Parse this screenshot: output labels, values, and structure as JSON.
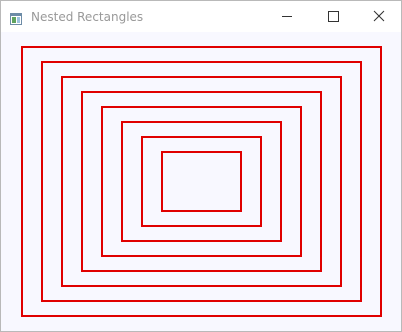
{
  "window": {
    "title": "Nested Rectangles",
    "controls": {
      "minimize_icon": "minimize-icon",
      "maximize_icon": "maximize-icon",
      "close_icon": "close-icon"
    },
    "app_icon": "window-app-icon"
  },
  "canvas": {
    "background_color": "#f8f8ff",
    "stroke_color": "#e00000",
    "rectangle_count": 8
  }
}
